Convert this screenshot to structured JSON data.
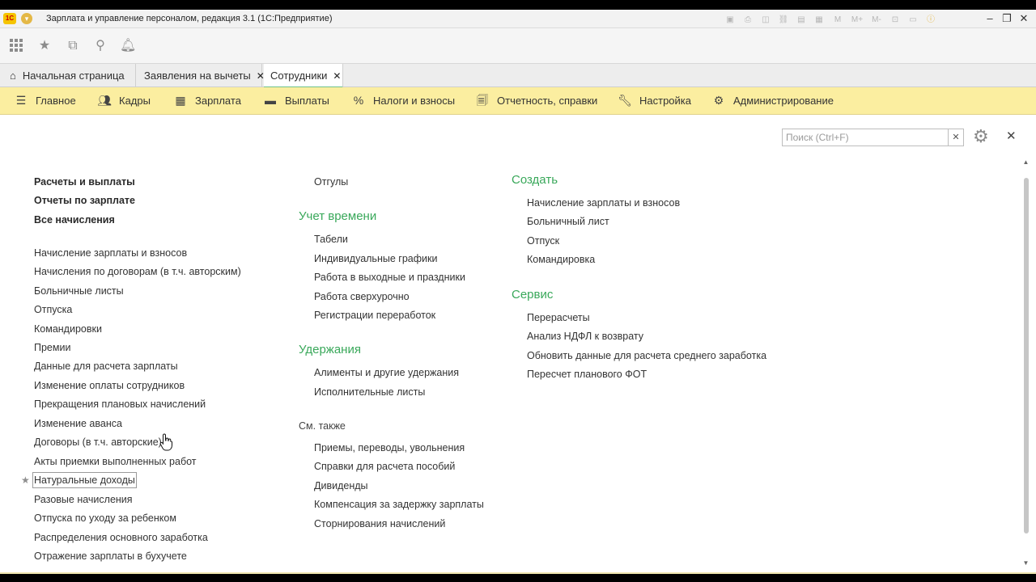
{
  "window": {
    "title": "Зарплата и управление персоналом, редакция 3.1  (1С:Предприятие)",
    "logo_text": "1С",
    "tools": [
      "M",
      "M+",
      "M-"
    ]
  },
  "tabs": [
    {
      "label": "Начальная страница",
      "closable": false
    },
    {
      "label": "Заявления на вычеты",
      "closable": true
    },
    {
      "label": "Сотрудники",
      "closable": true,
      "active": true
    }
  ],
  "sections": [
    {
      "label": "Главное",
      "icon": "menu-icon"
    },
    {
      "label": "Кадры",
      "icon": "people-icon"
    },
    {
      "label": "Зарплата",
      "icon": "calculator-icon"
    },
    {
      "label": "Выплаты",
      "icon": "card-icon"
    },
    {
      "label": "Налоги и взносы",
      "icon": "percent-icon"
    },
    {
      "label": "Отчетность, справки",
      "icon": "reports-icon"
    },
    {
      "label": "Настройка",
      "icon": "wrench-icon"
    },
    {
      "label": "Администрирование",
      "icon": "gear-icon"
    }
  ],
  "search": {
    "placeholder": "Поиск (Ctrl+F)",
    "value": ""
  },
  "col1": {
    "bold_links": [
      "Расчеты и выплаты",
      "Отчеты по зарплате",
      "Все начисления"
    ],
    "links": [
      "Начисление зарплаты и взносов",
      "Начисления по договорам (в т.ч. авторским)",
      "Больничные листы",
      "Отпуска",
      "Командировки",
      "Премии",
      "Данные для расчета зарплаты",
      "Изменение оплаты сотрудников",
      "Прекращения плановых начислений",
      "Изменение аванса",
      "Договоры (в т.ч. авторские)",
      "Акты приемки выполненных работ",
      "Натуральные доходы",
      "Разовые начисления",
      "Отпуска по уходу за ребенком",
      "Распределения основного заработка",
      "Отражение зарплаты в бухучете"
    ]
  },
  "col2": {
    "top_links": [
      "Отгулы"
    ],
    "time_title": "Учет времени",
    "time_links": [
      "Табели",
      "Индивидуальные графики",
      "Работа в выходные и праздники",
      "Работа сверхурочно",
      "Регистрации переработок"
    ],
    "deductions_title": "Удержания",
    "deductions_links": [
      "Алименты и другие удержания",
      "Исполнительные листы"
    ],
    "see_also_title": "См. также",
    "see_also_links": [
      "Приемы, переводы, увольнения",
      "Справки для расчета пособий",
      "Дивиденды",
      "Компенсация за задержку зарплаты",
      "Сторнирования начислений"
    ]
  },
  "col3": {
    "create_title": "Создать",
    "create_links": [
      "Начисление зарплаты и взносов",
      "Больничный лист",
      "Отпуск",
      "Командировка"
    ],
    "service_title": "Сервис",
    "service_links": [
      "Перерасчеты",
      "Анализ НДФЛ к возврату",
      "Обновить данные для расчета среднего заработка",
      "Пересчет планового ФОТ"
    ]
  }
}
